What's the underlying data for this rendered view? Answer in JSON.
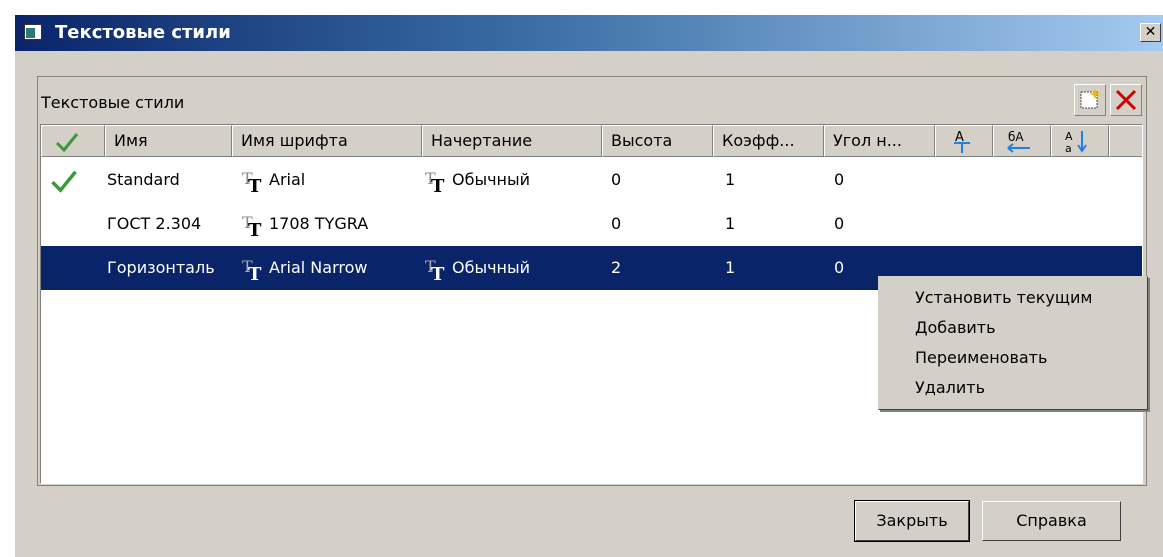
{
  "window": {
    "title": "Текстовые стили",
    "close_glyph": "✕"
  },
  "group": {
    "label": "Текстовые стили",
    "toolbar": [
      "new-style-icon",
      "delete-style-icon"
    ]
  },
  "columns": [
    "",
    "Имя",
    "Имя шрифта",
    "Начертание",
    "Высота",
    "Коэфф...",
    "Угол н...",
    "",
    "",
    ""
  ],
  "column_icons": [
    "check-icon",
    "",
    "",
    "",
    "",
    "",
    "",
    "align-icon",
    "case-icon",
    "sort-icon"
  ],
  "rows": [
    {
      "current": true,
      "name": "Standard",
      "font": "Arial",
      "style": "Обычный",
      "height": "0",
      "coef": "1",
      "angle": "0",
      "selected": false
    },
    {
      "current": false,
      "name": "ГОСТ 2.304",
      "font": "1708 TYGRA",
      "style": "",
      "height": "0",
      "coef": "1",
      "angle": "0",
      "selected": false
    },
    {
      "current": false,
      "name": "Горизонталь",
      "font": "Arial Narrow",
      "style": "Обычный",
      "height": "2",
      "coef": "1",
      "angle": "0",
      "selected": true
    }
  ],
  "context_menu": [
    "Установить текущим",
    "Добавить",
    "Переименовать",
    "Удалить"
  ],
  "buttons": {
    "close": "Закрыть",
    "help": "Справка"
  },
  "colors": {
    "selection": "#0a246a",
    "check": "#3a9a3a",
    "delete": "#cc0000"
  }
}
